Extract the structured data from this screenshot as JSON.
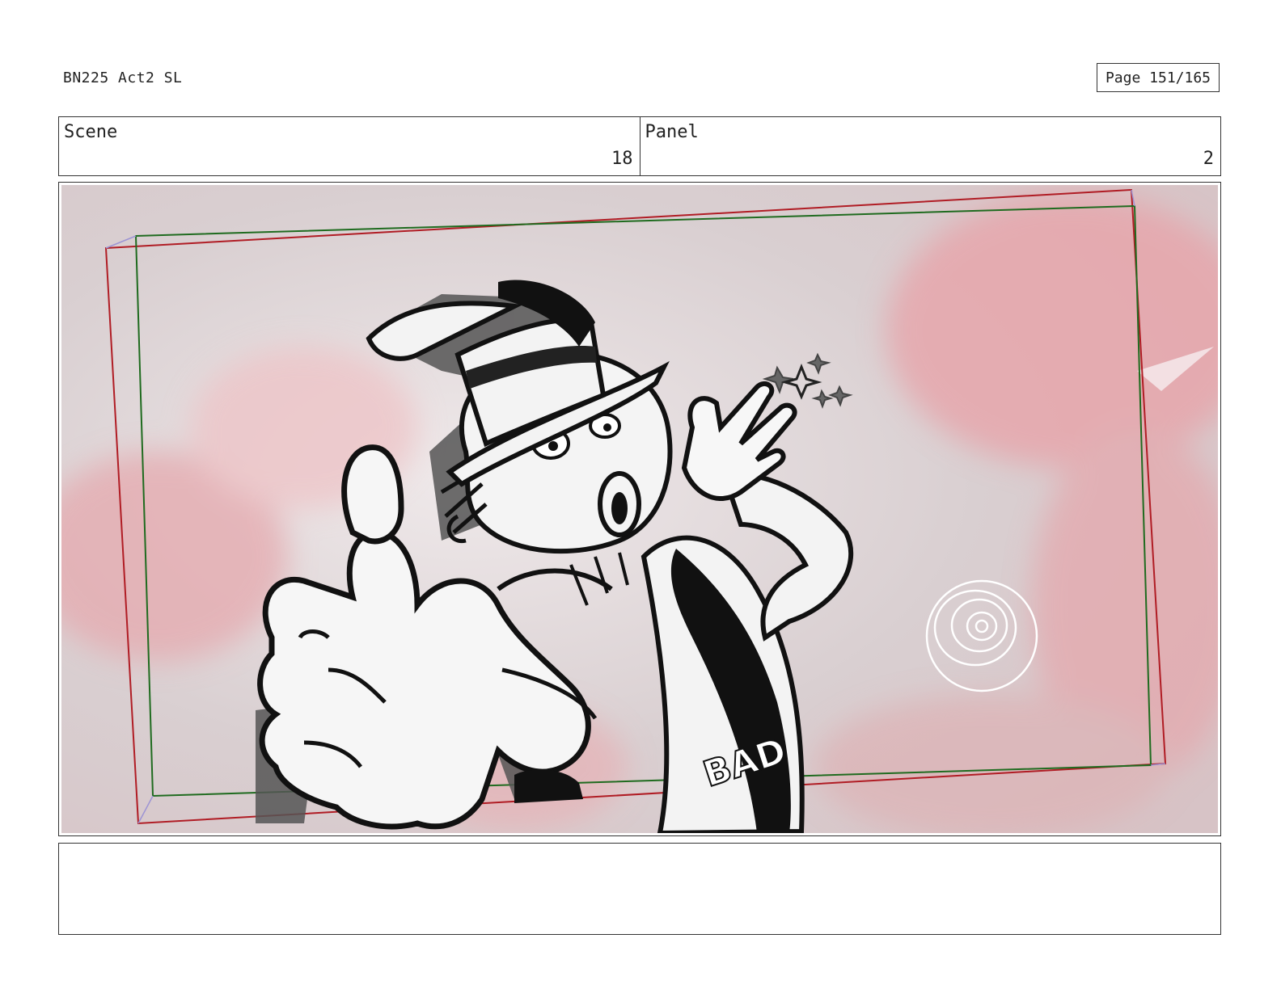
{
  "document": {
    "title": "BN225 Act2 SL",
    "page_label": "Page 151/165"
  },
  "header": {
    "scene_label": "Scene",
    "scene_number": "18",
    "panel_label": "Panel",
    "panel_number": "2"
  },
  "drawing": {
    "sash_text": "BAD",
    "colors": {
      "frame_red": "#b01c24",
      "frame_green": "#1f6b1f",
      "background_pink": "#e9b8bc"
    }
  },
  "notes": {
    "text": ""
  }
}
